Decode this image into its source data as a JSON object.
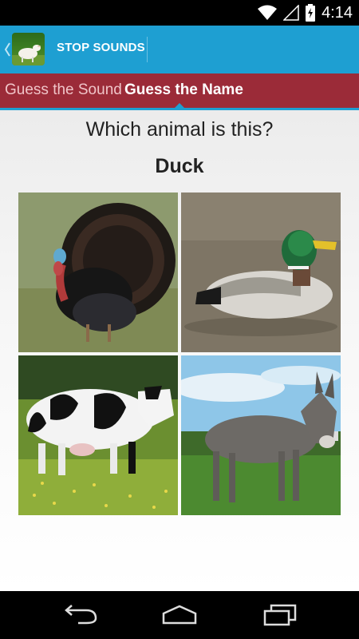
{
  "status_bar": {
    "time": "4:14",
    "icons": [
      "wifi-icon",
      "signal-icon",
      "battery-charging-icon"
    ]
  },
  "action_bar": {
    "title": "STOP SOUNDS",
    "app_icon": "lamb-icon",
    "background_color": "#1e9fd2"
  },
  "tabs": [
    {
      "label": "Guess the Sound",
      "selected": false
    },
    {
      "label": "Guess the Name",
      "selected": true
    }
  ],
  "tab_bar_color": "#9b2b38",
  "quiz": {
    "question": "Which animal is this?",
    "answer": "Duck",
    "choices": [
      "turkey",
      "duck",
      "cow",
      "donkey"
    ]
  },
  "nav_bar": {
    "buttons": [
      "back-icon",
      "home-icon",
      "recent-apps-icon"
    ]
  }
}
